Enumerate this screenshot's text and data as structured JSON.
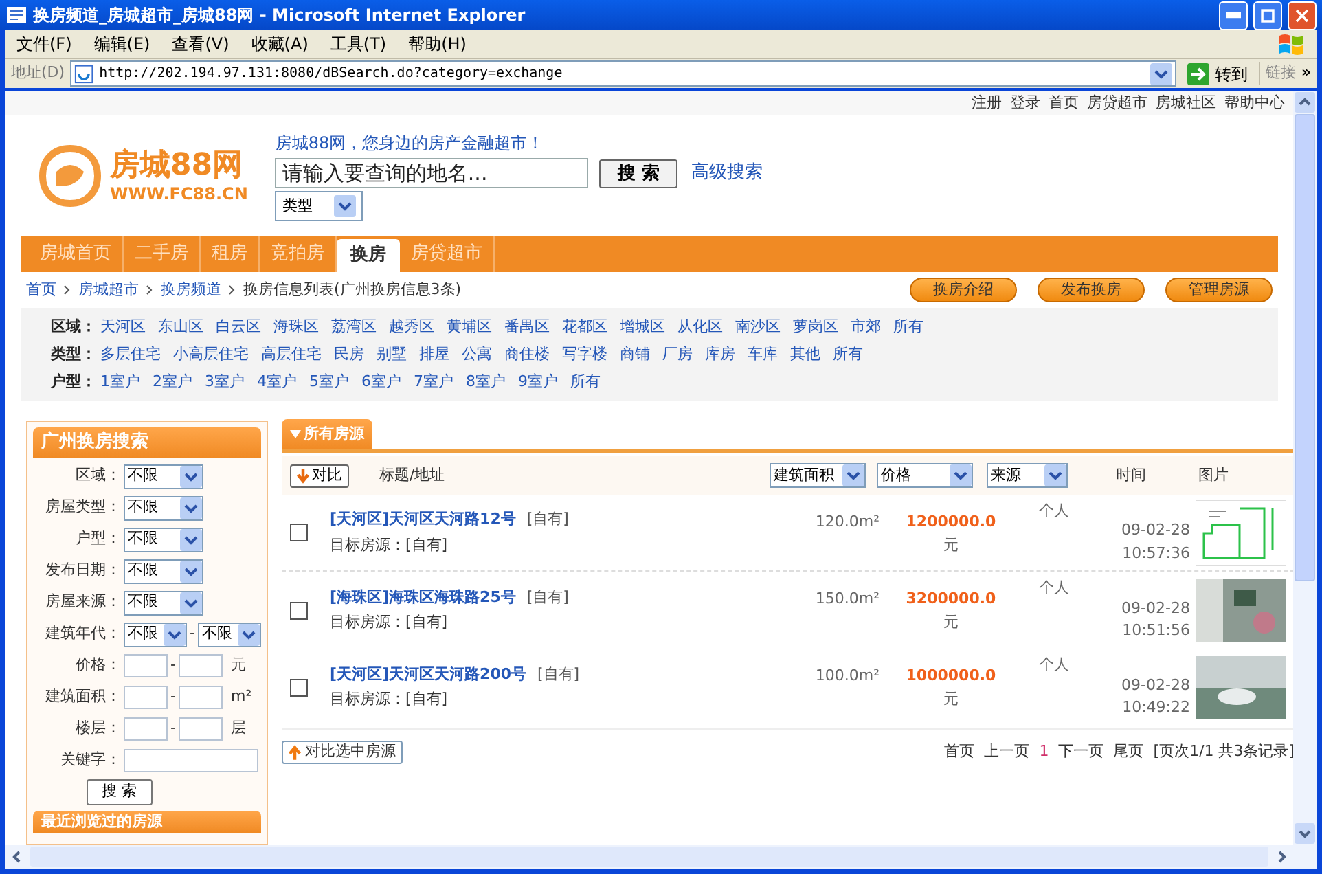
{
  "window": {
    "title": "换房频道_房城超市_房城88网 - Microsoft Internet Explorer"
  },
  "menu_bar": [
    "文件(F)",
    "编辑(E)",
    "查看(V)",
    "收藏(A)",
    "工具(T)",
    "帮助(H)"
  ],
  "address_bar": {
    "label": "地址(D)",
    "url": "http://202.194.97.131:8080/dBSearch.do?category=exchange",
    "go_button": "转到",
    "links": "链接",
    "more": "»"
  },
  "top_links": [
    "注册",
    "登录",
    "首页",
    "房贷超市",
    "房城社区",
    "帮助中心"
  ],
  "header": {
    "logo_text": "房城88网",
    "logo_url": "WWW.FC88.CN",
    "tagline": "房城88网，您身边的房产金融超市！",
    "search_placeholder": "请输入要查询的地名...",
    "search_button": "搜 索",
    "advanced_search": "高级搜索",
    "type_select": "类型"
  },
  "nav_tabs": [
    {
      "label": "房城首页",
      "selected": false
    },
    {
      "label": "二手房",
      "selected": false
    },
    {
      "label": "租房",
      "selected": false
    },
    {
      "label": "竞拍房",
      "selected": false
    },
    {
      "label": "换房",
      "selected": true
    },
    {
      "label": "房贷超市",
      "selected": false
    }
  ],
  "breadcrumb": [
    "首页",
    "房城超市",
    "换房频道",
    "换房信息列表(广州换房信息3条)"
  ],
  "action_buttons": [
    "换房介绍",
    "发布换房",
    "管理房源"
  ],
  "filters": [
    {
      "label": "区域：",
      "options": [
        "天河区",
        "东山区",
        "白云区",
        "海珠区",
        "荔湾区",
        "越秀区",
        "黄埔区",
        "番禺区",
        "花都区",
        "增城区",
        "从化区",
        "南沙区",
        "萝岗区",
        "市郊",
        "所有"
      ]
    },
    {
      "label": "类型：",
      "options": [
        "多层住宅",
        "小高层住宅",
        "高层住宅",
        "民房",
        "别墅",
        "排屋",
        "公寓",
        "商住楼",
        "写字楼",
        "商铺",
        "厂房",
        "库房",
        "车库",
        "其他",
        "所有"
      ]
    },
    {
      "label": "户型：",
      "options": [
        "1室户",
        "2室户",
        "3室户",
        "4室户",
        "5室户",
        "6室户",
        "7室户",
        "8室户",
        "9室户",
        "所有"
      ]
    }
  ],
  "sidebar_search": {
    "title": "广州换房搜索",
    "fields": [
      {
        "kind": "select",
        "label": "区域：",
        "values": [
          "不限"
        ]
      },
      {
        "kind": "select",
        "label": "房屋类型：",
        "values": [
          "不限"
        ]
      },
      {
        "kind": "select",
        "label": "户型：",
        "values": [
          "不限"
        ]
      },
      {
        "kind": "select",
        "label": "发布日期：",
        "values": [
          "不限"
        ]
      },
      {
        "kind": "select",
        "label": "房屋来源：",
        "values": [
          "不限"
        ]
      },
      {
        "kind": "select",
        "label": "建筑年代：",
        "values": [
          "不限",
          "不限"
        ],
        "separator": "-"
      },
      {
        "kind": "range",
        "label": "价格：",
        "separator": "-",
        "unit": "元"
      },
      {
        "kind": "range",
        "label": "建筑面积：",
        "separator": "-",
        "unit": "m²"
      },
      {
        "kind": "range",
        "label": "楼层：",
        "separator": "-",
        "unit": "层"
      },
      {
        "kind": "text",
        "label": "关键字："
      }
    ],
    "search_button": "搜 索",
    "recent_title": "最近浏览过的房源"
  },
  "listing": {
    "tab_title": "所有房源",
    "compare_button": "对比",
    "title_column": "标题/地址",
    "sort_selects": [
      "建筑面积",
      "价格",
      "来源"
    ],
    "columns": [
      "时间",
      "图片"
    ],
    "rows": [
      {
        "checked": false,
        "title": "[天河区]天河区天河路12号",
        "tag": "[自有]",
        "target": "目标房源：[自有]",
        "area": "120.0m²",
        "price": "1200000.0",
        "unit": "元",
        "source": "个人",
        "date": "09-02-28",
        "time": "10:57:36",
        "picture": {
          "kind": "floor_plan"
        }
      },
      {
        "checked": false,
        "title": "[海珠区]海珠区海珠路25号",
        "tag": "[自有]",
        "target": "目标房源：[自有]",
        "area": "150.0m²",
        "price": "3200000.0",
        "unit": "元",
        "source": "个人",
        "date": "09-02-28",
        "time": "10:51:56",
        "picture": {
          "kind": "photo"
        }
      },
      {
        "checked": false,
        "title": "[天河区]天河区天河路200号",
        "tag": "[自有]",
        "target": "目标房源：[自有]",
        "area": "100.0m²",
        "price": "1000000.0",
        "unit": "元",
        "source": "个人",
        "date": "09-02-28",
        "time": "10:49:22",
        "picture": {
          "kind": "photo"
        }
      }
    ],
    "compare_selected_button": "对比选中房源",
    "pagination": [
      {
        "label": "首页",
        "selected": false
      },
      {
        "label": "上一页",
        "selected": false
      },
      {
        "label": "1",
        "selected": true
      },
      {
        "label": "下一页",
        "selected": false
      },
      {
        "label": "尾页",
        "selected": false
      }
    ],
    "page_info": "[页次1/1 共3条记录]"
  }
}
